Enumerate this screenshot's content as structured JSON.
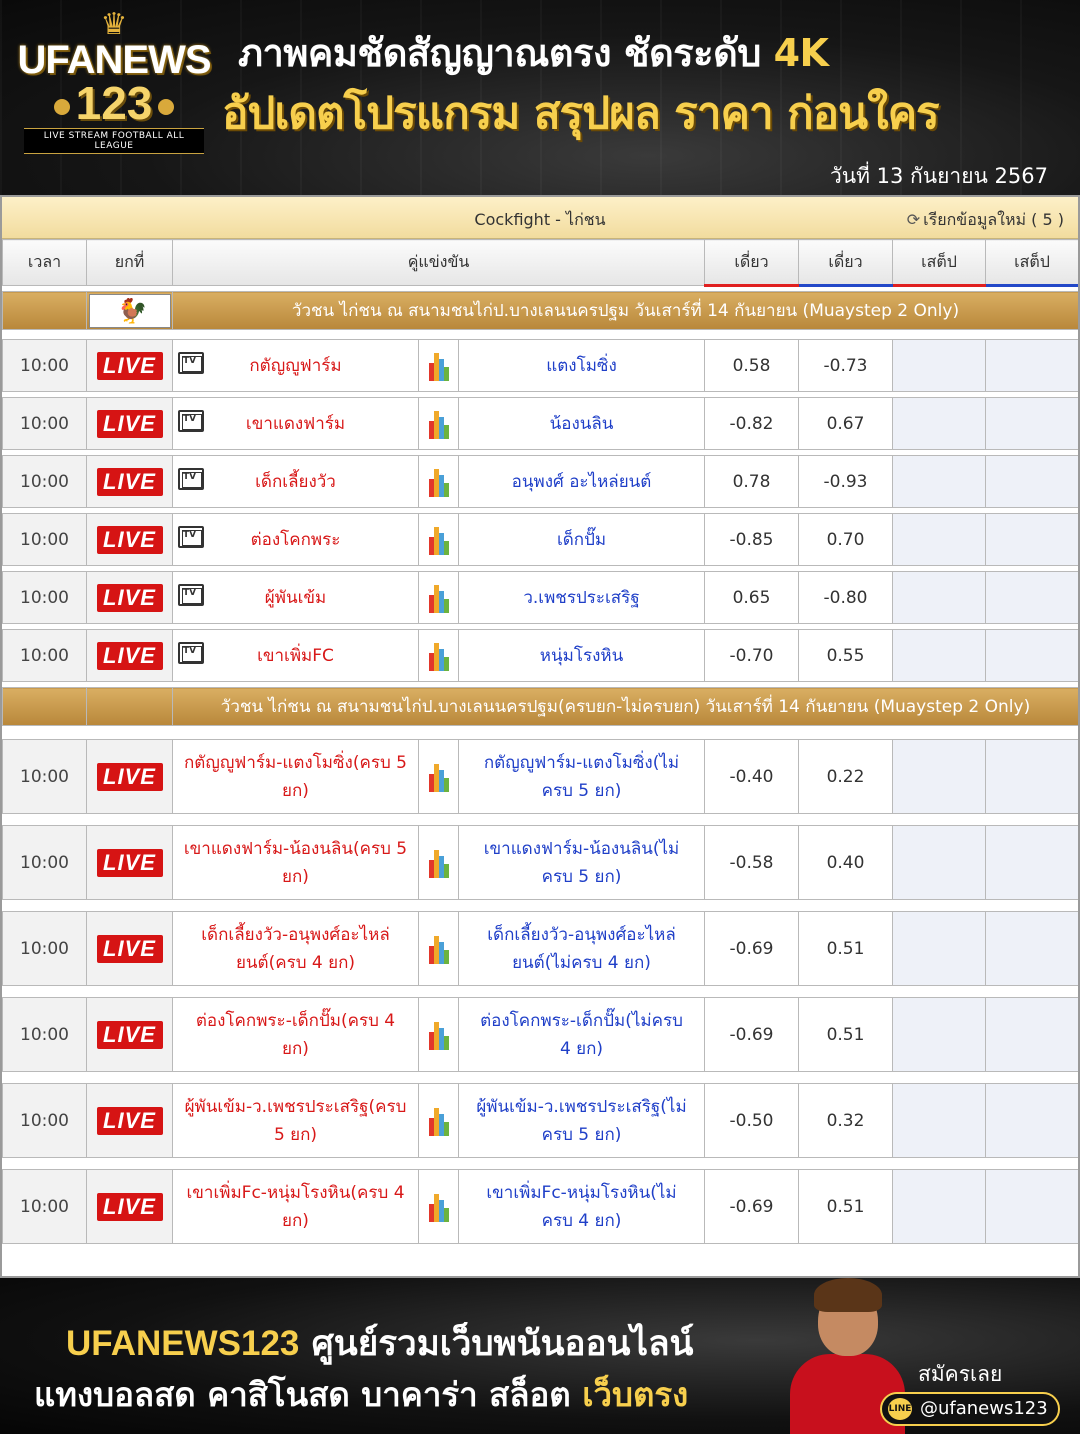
{
  "header": {
    "logo_brand": "UFANEWS",
    "logo_number": "123",
    "logo_tagline": "LIVE STREAM FOOTBALL ALL LEAGUE",
    "line1": "ภาพคมชัดสัญญาณตรง ชัดระดับ ",
    "line1_highlight": "4K",
    "line2": "อัปเดตโปรแกรม สรุปผล ราคา ก่อนใคร",
    "date": "วันที่ 13 กันยายน 2567"
  },
  "panel": {
    "title": "Cockfight - ไก่ชน",
    "refresh_label": "เรียกข้อมูลใหม่ ( 5 )",
    "columns": [
      "เวลา",
      "ยกที่",
      "คู่แข่งขัน",
      "เดี่ยว",
      "เดี่ยว",
      "เสต็ป",
      "เสต็ป"
    ],
    "live_label": "LIVE"
  },
  "leagues": [
    {
      "name": "วัวชน ไก่ชน ณ สนามชนไก่ป.บางเลนนครปฐม วันเสาร์ที่ 14 กันยายน (Muaystep 2 Only)",
      "matches": [
        {
          "time": "10:00",
          "home": "กตัญญูฟาร์ม",
          "away": "แตงโมซิ่ง",
          "odd1": "0.58",
          "odd2": "-0.73"
        },
        {
          "time": "10:00",
          "home": "เขาแดงฟาร์ม",
          "away": "น้องนลิน",
          "odd1": "-0.82",
          "odd2": "0.67"
        },
        {
          "time": "10:00",
          "home": "เด็กเลี้ยงวัว",
          "away": "อนุพงศ์ อะไหล่ยนต์",
          "odd1": "0.78",
          "odd2": "-0.93"
        },
        {
          "time": "10:00",
          "home": "ต่องโคกพระ",
          "away": "เด็กปั๊ม",
          "odd1": "-0.85",
          "odd2": "0.70"
        },
        {
          "time": "10:00",
          "home": "ผู้พันเข้ม",
          "away": "ว.เพชรประเสริฐ",
          "odd1": "0.65",
          "odd2": "-0.80"
        },
        {
          "time": "10:00",
          "home": "เขาเพิ่มFC",
          "away": "หนุ่มโรงหิน",
          "odd1": "-0.70",
          "odd2": "0.55"
        }
      ]
    },
    {
      "name": "วัวชน ไก่ชน ณ สนามชนไก่ป.บางเลนนครปฐม(ครบยก-ไม่ครบยก) วันเสาร์ที่ 14 กันยายน (Muaystep 2 Only)",
      "matches": [
        {
          "time": "10:00",
          "home": "กตัญญูฟาร์ม-แตงโมซิ่ง(ครบ 5 ยก)",
          "away": "กตัญญูฟาร์ม-แตงโมซิ่ง(ไม่ครบ 5 ยก)",
          "odd1": "-0.40",
          "odd2": "0.22"
        },
        {
          "time": "10:00",
          "home": "เขาแดงฟาร์ม-น้องนลิน(ครบ 5 ยก)",
          "away": "เขาแดงฟาร์ม-น้องนลิน(ไม่ครบ 5 ยก)",
          "odd1": "-0.58",
          "odd2": "0.40"
        },
        {
          "time": "10:00",
          "home": "เด็กเลี้ยงวัว-อนุพงศ์อะไหล่ยนต์(ครบ 4 ยก)",
          "away": "เด็กเลี้ยงวัว-อนุพงศ์อะไหล่ยนต์(ไม่ครบ 4 ยก)",
          "odd1": "-0.69",
          "odd2": "0.51"
        },
        {
          "time": "10:00",
          "home": "ต่องโคกพระ-เด็กปั๊ม(ครบ 4 ยก)",
          "away": "ต่องโคกพระ-เด็กปั๊ม(ไม่ครบ 4 ยก)",
          "odd1": "-0.69",
          "odd2": "0.51"
        },
        {
          "time": "10:00",
          "home": "ผู้พันเข้ม-ว.เพชรประเสริฐ(ครบ 5 ยก)",
          "away": "ผู้พันเข้ม-ว.เพชรประเสริฐ(ไม่ครบ 5 ยก)",
          "odd1": "-0.50",
          "odd2": "0.32"
        },
        {
          "time": "10:00",
          "home": "เขาเพิ่มFc-หนุ่มโรงหิน(ครบ 4 ยก)",
          "away": "เขาเพิ่มFc-หนุ่มโรงหิน(ไม่ครบ 4 ยก)",
          "odd1": "-0.69",
          "odd2": "0.51"
        }
      ]
    }
  ],
  "footer": {
    "brand": "UFANEWS123",
    "line1_rest": " ศูนย์รวมเว็บพนันออนไลน์",
    "line2": "แทงบอลสด คาสิโนสด บาคาร่า สล็อต ",
    "line2_highlight": "เว็บตรง",
    "signup": "สมัครเลย",
    "handle": "@ufanews123",
    "line_app": "LINE"
  }
}
